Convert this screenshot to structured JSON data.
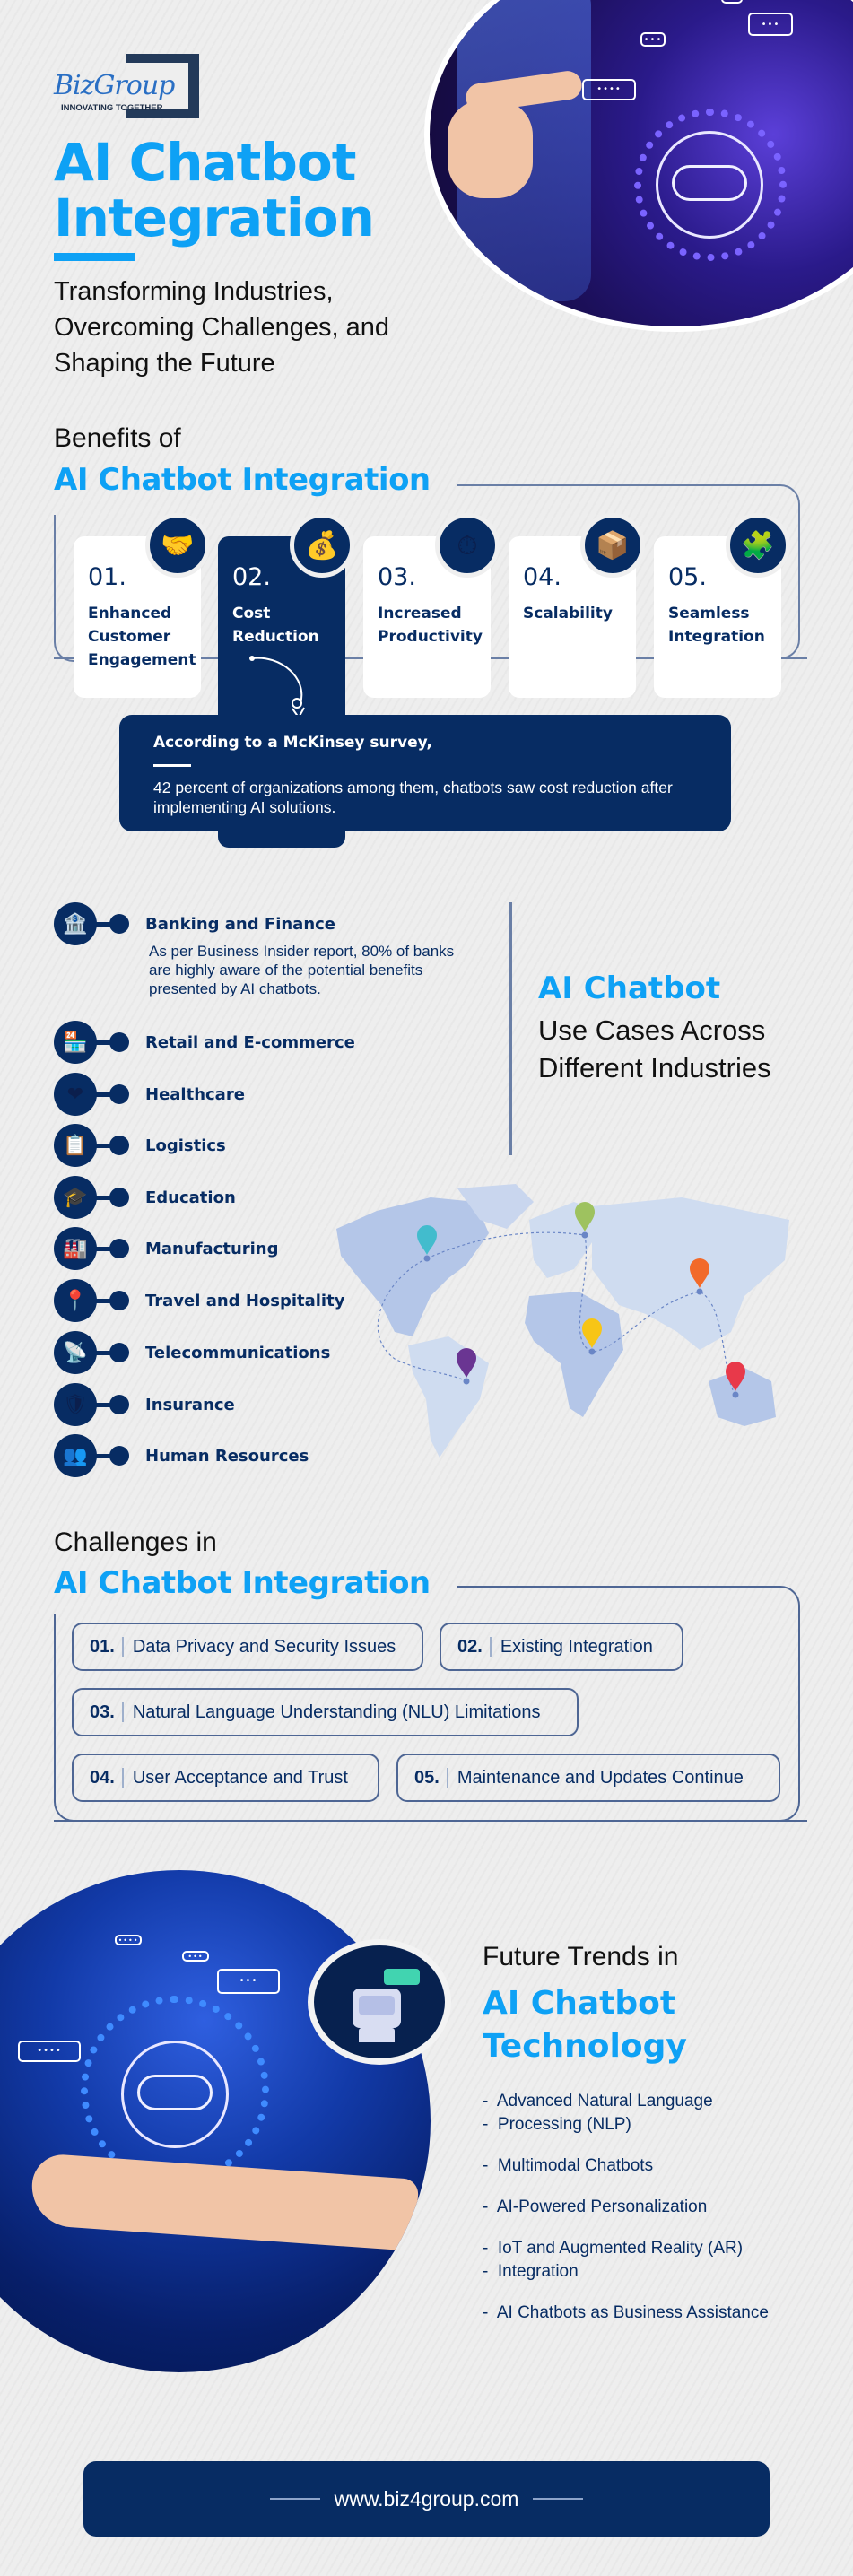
{
  "brand": {
    "logo_text": "BizGroup",
    "logo_tagline": "INNOVATING TOGETHER",
    "website": "www.biz4group.com"
  },
  "colors": {
    "accent_blue": "#0ea1f5",
    "navy": "#072c63",
    "background": "#eeeeee"
  },
  "hero": {
    "title_line1": "AI Chatbot",
    "title_line2": "Integration",
    "subtitle": "Transforming Industries, Overcoming Challenges, and Shaping the Future",
    "image_bubbles": [
      "••••",
      "•••",
      "•••",
      "•••",
      "••••"
    ]
  },
  "benefits": {
    "kicker": "Benefits of",
    "title": "AI Chatbot Integration",
    "items": [
      {
        "num": "01.",
        "label": "Enhanced Customer Engagement",
        "icon": "handshake-icon",
        "glyph": "🤝"
      },
      {
        "num": "02.",
        "label": "Cost Reduction",
        "icon": "money-bag-chart-icon",
        "glyph": "💰"
      },
      {
        "num": "03.",
        "label": "Increased Productivity",
        "icon": "speedometer-arrows-icon",
        "glyph": "⏱"
      },
      {
        "num": "04.",
        "label": "Scalability",
        "icon": "cube-arrows-icon",
        "glyph": "📦"
      },
      {
        "num": "05.",
        "label": "Seamless Integration",
        "icon": "puzzle-icon",
        "glyph": "🧩"
      }
    ],
    "callout": {
      "heading": "According to a McKinsey survey,",
      "body": "42 percent of organizations among them, chatbots saw cost reduction after implementing AI solutions."
    }
  },
  "use_cases": {
    "title_accent": "AI Chatbot",
    "title_rest": "Use Cases Across Different Industries",
    "industries": [
      {
        "label": "Banking and Finance",
        "icon": "bank-icon",
        "glyph": "🏦",
        "description": "As per Business Insider report, 80% of banks are highly aware of the potential benefits presented by AI chatbots."
      },
      {
        "label": "Retail and E-commerce",
        "icon": "store-cart-icon",
        "glyph": "🏪"
      },
      {
        "label": "Healthcare",
        "icon": "heart-hand-icon",
        "glyph": "❤"
      },
      {
        "label": "Logistics",
        "icon": "boxes-clipboard-icon",
        "glyph": "📋"
      },
      {
        "label": "Education",
        "icon": "graduation-books-icon",
        "glyph": "🎓"
      },
      {
        "label": "Manufacturing",
        "icon": "robot-arm-icon",
        "glyph": "🏭"
      },
      {
        "label": "Travel and Hospitality",
        "icon": "map-pins-icon",
        "glyph": "📍"
      },
      {
        "label": "Telecommunications",
        "icon": "antenna-tower-icon",
        "glyph": "📡"
      },
      {
        "label": "Insurance",
        "icon": "shield-check-icon",
        "glyph": "🛡"
      },
      {
        "label": "Human Resources",
        "icon": "team-gear-icon",
        "glyph": "👥"
      }
    ],
    "map_pins": [
      {
        "region": "North America",
        "color": "#42bccd"
      },
      {
        "region": "Europe",
        "color": "#9ec25f"
      },
      {
        "region": "Asia",
        "color": "#f26a2a"
      },
      {
        "region": "Africa",
        "color": "#f7c516"
      },
      {
        "region": "South America",
        "color": "#6a3592"
      },
      {
        "region": "Australia",
        "color": "#e8394a"
      }
    ]
  },
  "challenges": {
    "kicker": "Challenges in",
    "title": "AI Chatbot Integration",
    "items": [
      {
        "num": "01.",
        "label": "Data Privacy and Security Issues"
      },
      {
        "num": "02.",
        "label": "Existing Integration"
      },
      {
        "num": "03.",
        "label": "Natural Language Understanding (NLU) Limitations"
      },
      {
        "num": "04.",
        "label": "User Acceptance and Trust"
      },
      {
        "num": "05.",
        "label": "Maintenance and Updates Continue"
      }
    ]
  },
  "future": {
    "kicker": "Future Trends in",
    "title_line1": "AI Chatbot",
    "title_line2": "Technology",
    "trends": [
      [
        "Advanced Natural Language",
        "Processing (NLP)"
      ],
      [
        "Multimodal Chatbots"
      ],
      [
        "AI-Powered Personalization"
      ],
      [
        "IoT and Augmented Reality (AR)",
        "Integration"
      ],
      [
        "AI Chatbots as Business Assistance"
      ]
    ]
  }
}
